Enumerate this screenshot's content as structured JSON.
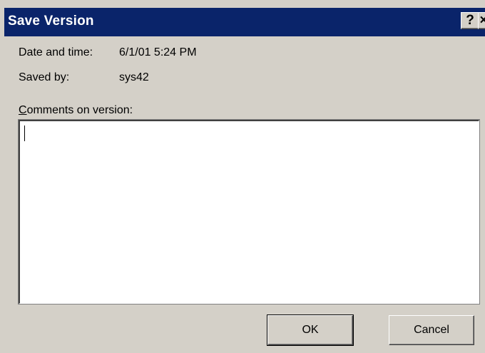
{
  "window": {
    "title": "Save Version",
    "help_button": "?",
    "close_button": "×"
  },
  "info": {
    "date_label": "Date and time:",
    "date_value": "6/1/01 5:24 PM",
    "saved_by_label": "Saved by:",
    "saved_by_value": "sys42"
  },
  "comments": {
    "label_mnemonic": "C",
    "label_rest": "omments on version:",
    "value": ""
  },
  "buttons": {
    "ok_label": "OK",
    "cancel_label": "Cancel"
  },
  "colors": {
    "titlebar": "#0a246a",
    "dialog_face": "#d4d0c8"
  }
}
